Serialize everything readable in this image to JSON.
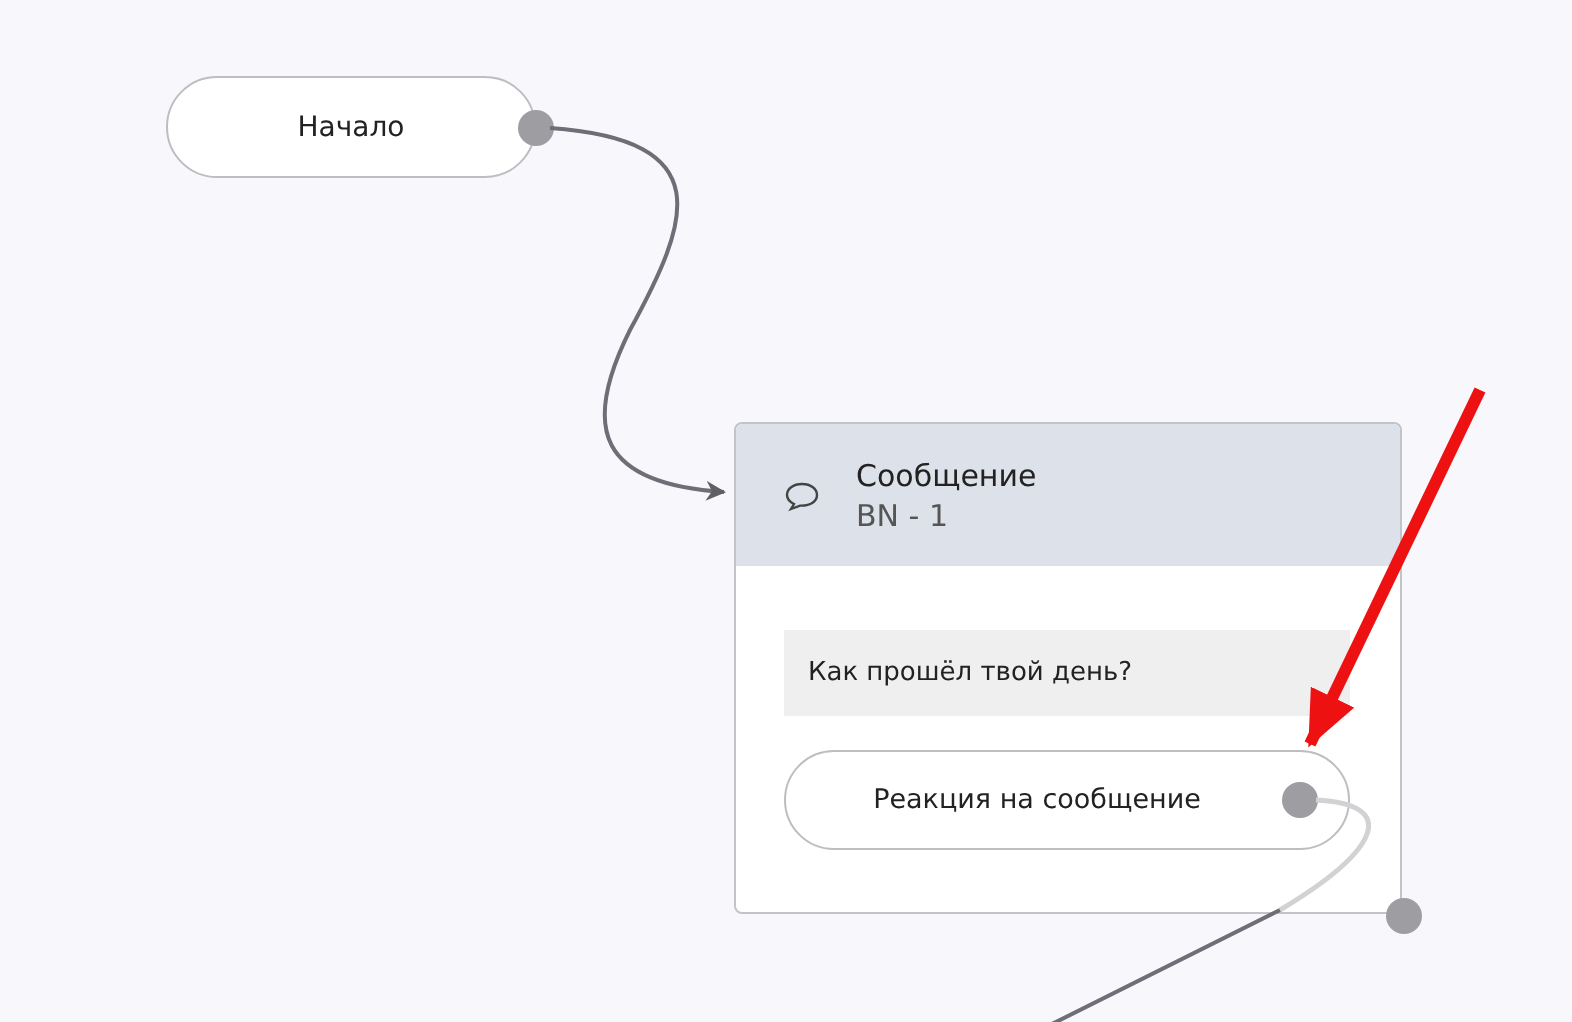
{
  "start_node": {
    "label": "Начало"
  },
  "message_node": {
    "title": "Сообщение",
    "subtitle": "BN - 1",
    "text": "Как прошёл твой день?",
    "reaction": {
      "label": "Реакция на сообщение"
    }
  }
}
